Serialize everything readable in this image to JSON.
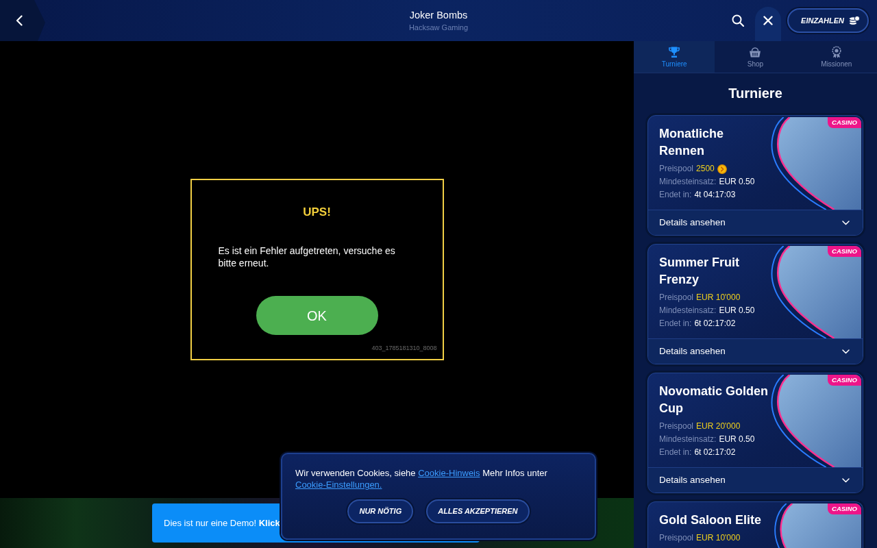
{
  "header": {
    "title": "Joker Bombs",
    "subtitle": "Hacksaw Gaming",
    "deposit_button": "EINZAHLEN"
  },
  "error_dialog": {
    "title": "UPS!",
    "message": "Es ist ein Fehler aufgetreten, versuche es bitte erneut.",
    "button": "OK",
    "code": "403_1785181310_8008"
  },
  "demo_banner": {
    "text": "Dies ist nur eine Demo! **Klick**"
  },
  "cookie_banner": {
    "message": [
      {
        "kind": "text",
        "text": "Wir verwenden Cookies, siehe"
      },
      {
        "kind": "link",
        "text": "Cookie-Hinweis"
      },
      {
        "kind": "text",
        "text": "Mehr Infos unter"
      },
      {
        "kind": "link",
        "text": "Cookie-Einstellungen."
      }
    ],
    "buttons": [
      "NUR NÖTIG",
      "ALLES AKZEPTIEREN"
    ]
  },
  "sidebar": {
    "tabs": [
      {
        "label": "Turniere",
        "selected": true
      },
      {
        "label": "Shop",
        "selected": false
      },
      {
        "label": "Missionen",
        "selected": false
      }
    ],
    "heading": "Turniere",
    "tournaments": [
      {
        "title": "Monatliche Rennen",
        "badge": "CASINO",
        "stats": [
          {
            "kind": "coins",
            "label": "Preispool",
            "value": "2500"
          },
          {
            "kind": "plain",
            "label": "Mindesteinsatz:",
            "value": "EUR 0.50"
          },
          {
            "kind": "plain",
            "label": "Endet in:",
            "value": "4t 04:17:03"
          }
        ],
        "details": "Details ansehen",
        "expanded": false
      },
      {
        "title": "Summer Fruit Frenzy",
        "badge": "CASINO",
        "stats": [
          {
            "kind": "prize",
            "label": "Preispool",
            "value": "EUR 10'000"
          },
          {
            "kind": "plain",
            "label": "Mindesteinsatz:",
            "value": "EUR 0.50"
          },
          {
            "kind": "plain",
            "label": "Endet in:",
            "value": "6t 02:17:02"
          }
        ],
        "details": "Details ansehen",
        "expanded": false
      },
      {
        "title": "Novomatic Golden Cup",
        "badge": "CASINO",
        "stats": [
          {
            "kind": "prize",
            "label": "Preispool",
            "value": "EUR 20'000"
          },
          {
            "kind": "plain",
            "label": "Mindesteinsatz:",
            "value": "EUR 0.50"
          },
          {
            "kind": "plain",
            "label": "Endet in:",
            "value": "6t 02:17:02"
          }
        ],
        "details": "Details ansehen",
        "expanded": false
      },
      {
        "title": "Gold Saloon Elite",
        "badge": "CASINO",
        "stats": [
          {
            "kind": "prize",
            "label": "Preispool",
            "value": "EUR 10'000"
          }
        ]
      }
    ]
  }
}
